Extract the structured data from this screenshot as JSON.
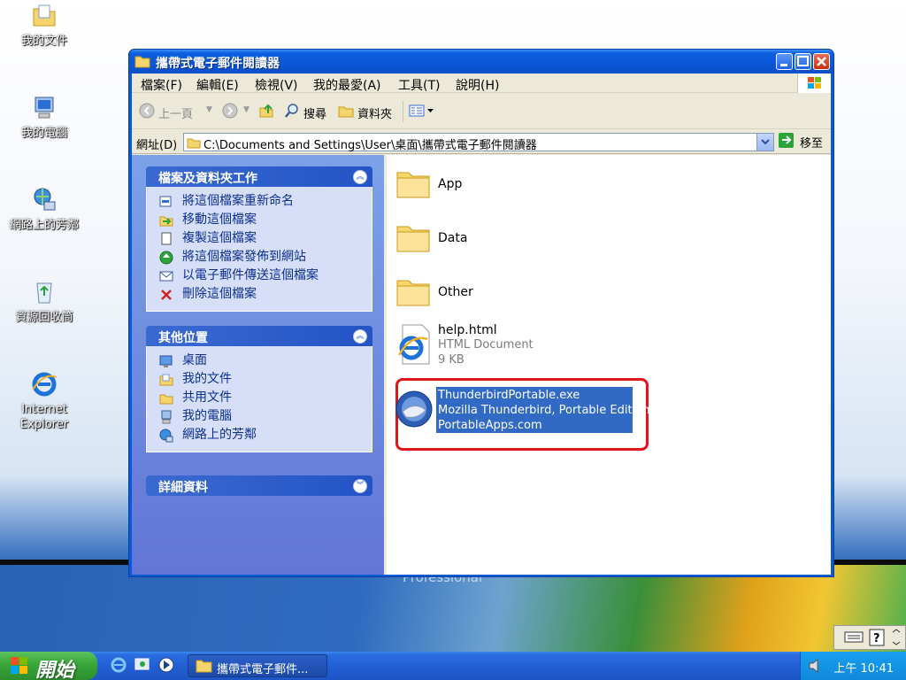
{
  "desktop": {
    "icons": [
      {
        "label": "我的文件",
        "icon": "folder-documents-icon"
      },
      {
        "label": "我的電腦",
        "icon": "computer-icon"
      },
      {
        "label": "網路上的芳鄰",
        "icon": "network-icon"
      },
      {
        "label": "資源回收筒",
        "icon": "recycle-bin-icon"
      },
      {
        "label": "Internet Explorer",
        "icon": "ie-icon"
      }
    ],
    "wallpaper_text": "Professional"
  },
  "window": {
    "title": "攜帶式電子郵件閱讀器",
    "menu": [
      "檔案(F)",
      "編輯(E)",
      "檢視(V)",
      "我的最愛(A)",
      "工具(T)",
      "說明(H)"
    ],
    "toolbar": {
      "back": "上一頁",
      "search": "搜尋",
      "folders": "資料夾"
    },
    "address": {
      "label": "網址(D)",
      "value": "C:\\Documents and Settings\\User\\桌面\\攜帶式電子郵件閱讀器",
      "go": "移至"
    },
    "tasks_panel": {
      "title": "檔案及資料夾工作",
      "items": [
        {
          "label": "將這個檔案重新命名",
          "icon": "rename-icon"
        },
        {
          "label": "移動這個檔案",
          "icon": "move-icon"
        },
        {
          "label": "複製這個檔案",
          "icon": "copy-icon"
        },
        {
          "label": "將這個檔案發佈到網站",
          "icon": "publish-icon"
        },
        {
          "label": "以電子郵件傳送這個檔案",
          "icon": "email-icon"
        },
        {
          "label": "刪除這個檔案",
          "icon": "delete-icon"
        }
      ]
    },
    "places_panel": {
      "title": "其他位置",
      "items": [
        {
          "label": "桌面",
          "icon": "desktop-icon"
        },
        {
          "label": "我的文件",
          "icon": "documents-icon"
        },
        {
          "label": "共用文件",
          "icon": "shared-folder-icon"
        },
        {
          "label": "我的電腦",
          "icon": "computer-icon"
        },
        {
          "label": "網路上的芳鄰",
          "icon": "network-icon"
        }
      ]
    },
    "details_panel": {
      "title": "詳細資料"
    },
    "files": [
      {
        "name": "App",
        "type": "folder"
      },
      {
        "name": "Data",
        "type": "folder"
      },
      {
        "name": "Other",
        "type": "folder"
      },
      {
        "name": "help.html",
        "desc": "HTML Document",
        "size": "9 KB",
        "type": "html"
      },
      {
        "name": "ThunderbirdPortable.exe",
        "desc": "Mozilla Thunderbird, Portable Edition",
        "company": "PortableApps.com",
        "type": "exe",
        "selected": true
      }
    ]
  },
  "taskbar": {
    "start": "開始",
    "task": "攜帶式電子郵件...",
    "clock": "上午 10:41"
  },
  "colors": {
    "selection": "#316ac5",
    "highlight_box": "#e0141a",
    "title_blue": "#0a56d6"
  }
}
